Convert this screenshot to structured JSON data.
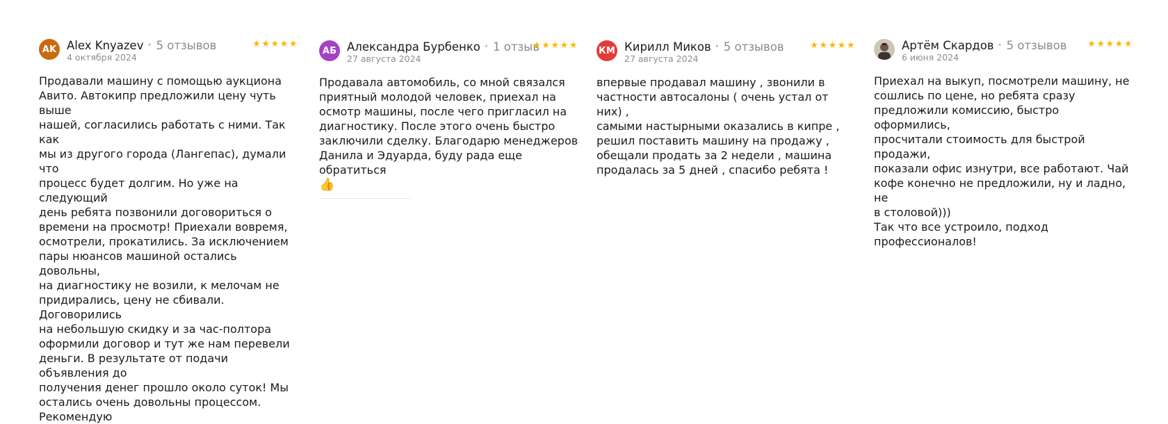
{
  "stars": "★★★★★",
  "colors": {
    "star": "#fbb800",
    "avatar_ak": "#c96a0f",
    "avatar_ab": "#a542c4",
    "avatar_km": "#e63a3a"
  },
  "reviews": [
    {
      "initials": "AK",
      "author": "Alex Knyazev",
      "review_count": "5 отзывов",
      "date": "4 октября 2024",
      "text": "Продавали машину с помощью аукциона\nАвито. Автокипр предложили цену чуть выше\nнашей, согласились работать с ними. Так как\nмы из другого города (Лангепас), думали что\nпроцесс будет долгим. Но уже на следующий\nдень ребята позвонили договориться о\nвремени на просмотр! Приехали вовремя,\nосмотрели, прокатились. За исключением\nпары нюансов машиной остались довольны,\nна диагностику не возили, к мелочам не\nпридирались, цену не сбивали. Договорились\nна небольшую скидку и за час-полтора\nоформили договор и тут же нам перевели\nденьги. В результате от подачи объявления до\nполучения денег прошло около суток! Мы\nостались очень довольны процессом.\nРекомендую"
    },
    {
      "initials": "АБ",
      "author": "Александра Бурбенко",
      "review_count": "1 отзыв",
      "date": "27 августа 2024",
      "text": "Продавала автомобиль, со мной связался\nприятный молодой человек, приехал на\nосмотр машины, после чего пригласил на\nдиагностику. После этого очень быстро\nзаключили сделку. Благодарю менеджеров\nДанила и Эдуарда, буду рада еще обратиться",
      "emoji": "👍"
    },
    {
      "initials": "КМ",
      "author": "Кирилл Миков",
      "review_count": "5 отзывов",
      "date": "27 августа 2024",
      "text": "впервые продавал машину , звонили в\nчастности автосалоны ( очень устал от них) ,\nсамыми настырными оказались в кипре ,\nрешил поставить машину на продажу ,\nобещали продать за 2 недели , машина\nпродалась за 5 дней , спасибо ребята !"
    },
    {
      "author": "Артём Скардов",
      "review_count": "5 отзывов",
      "date": "6 июня 2024",
      "text": "Приехал на выкуп, посмотрели машину, не\nсошлись по цене, но ребята сразу\nпредложили комиссию, быстро оформились,\nпросчитали стоимость для быстрой продажи,\nпоказали офис изнутри, все работают. Чай\nкофе конечно не предложили, ну и ладно, не\nв столовой)))\nТак что все устроило, подход\nпрофессионалов!"
    }
  ]
}
